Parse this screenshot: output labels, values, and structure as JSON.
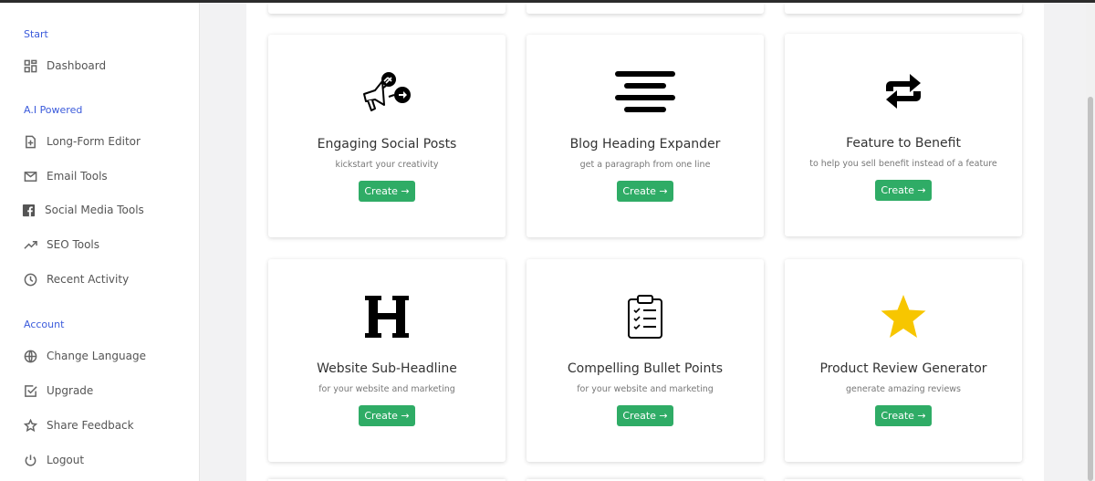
{
  "sidebar": {
    "sections": [
      {
        "title": "Start",
        "items": [
          {
            "label": "Dashboard",
            "icon": "dashboard-icon"
          }
        ]
      },
      {
        "title": "A.I Powered",
        "items": [
          {
            "label": "Long-Form Editor",
            "icon": "file-plus-icon"
          },
          {
            "label": "Email Tools",
            "icon": "mail-icon"
          },
          {
            "label": "Social Media Tools",
            "icon": "facebook-icon"
          },
          {
            "label": "SEO Tools",
            "icon": "trending-up-icon"
          },
          {
            "label": "Recent Activity",
            "icon": "clock-icon"
          }
        ]
      },
      {
        "title": "Account",
        "items": [
          {
            "label": "Change Language",
            "icon": "globe-icon"
          },
          {
            "label": "Upgrade",
            "icon": "check-square-icon"
          },
          {
            "label": "Share Feedback",
            "icon": "star-outline-icon"
          },
          {
            "label": "Logout",
            "icon": "power-icon"
          }
        ]
      }
    ]
  },
  "cards": [
    {
      "title": "Engaging Social Posts",
      "subtitle": "kickstart your creativity",
      "button": "Create →",
      "icon": "megaphone-share-icon"
    },
    {
      "title": "Blog Heading Expander",
      "subtitle": "get a paragraph from one line",
      "button": "Create →",
      "icon": "align-center-lines-icon"
    },
    {
      "title": "Feature to Benefit",
      "subtitle": "to help you sell benefit instead of a feature",
      "button": "Create →",
      "icon": "swap-arrows-icon"
    },
    {
      "title": "Website Sub-Headline",
      "subtitle": "for your website and marketing",
      "button": "Create →",
      "icon": "heading-h-icon"
    },
    {
      "title": "Compelling Bullet Points",
      "subtitle": "for your website and marketing",
      "button": "Create →",
      "icon": "clipboard-checklist-icon"
    },
    {
      "title": "Product Review Generator",
      "subtitle": "generate amazing reviews",
      "button": "Create →",
      "icon": "star-icon"
    }
  ],
  "colors": {
    "accent": "#3b5bdb",
    "button": "#2fac66",
    "star": "#f7c600"
  }
}
